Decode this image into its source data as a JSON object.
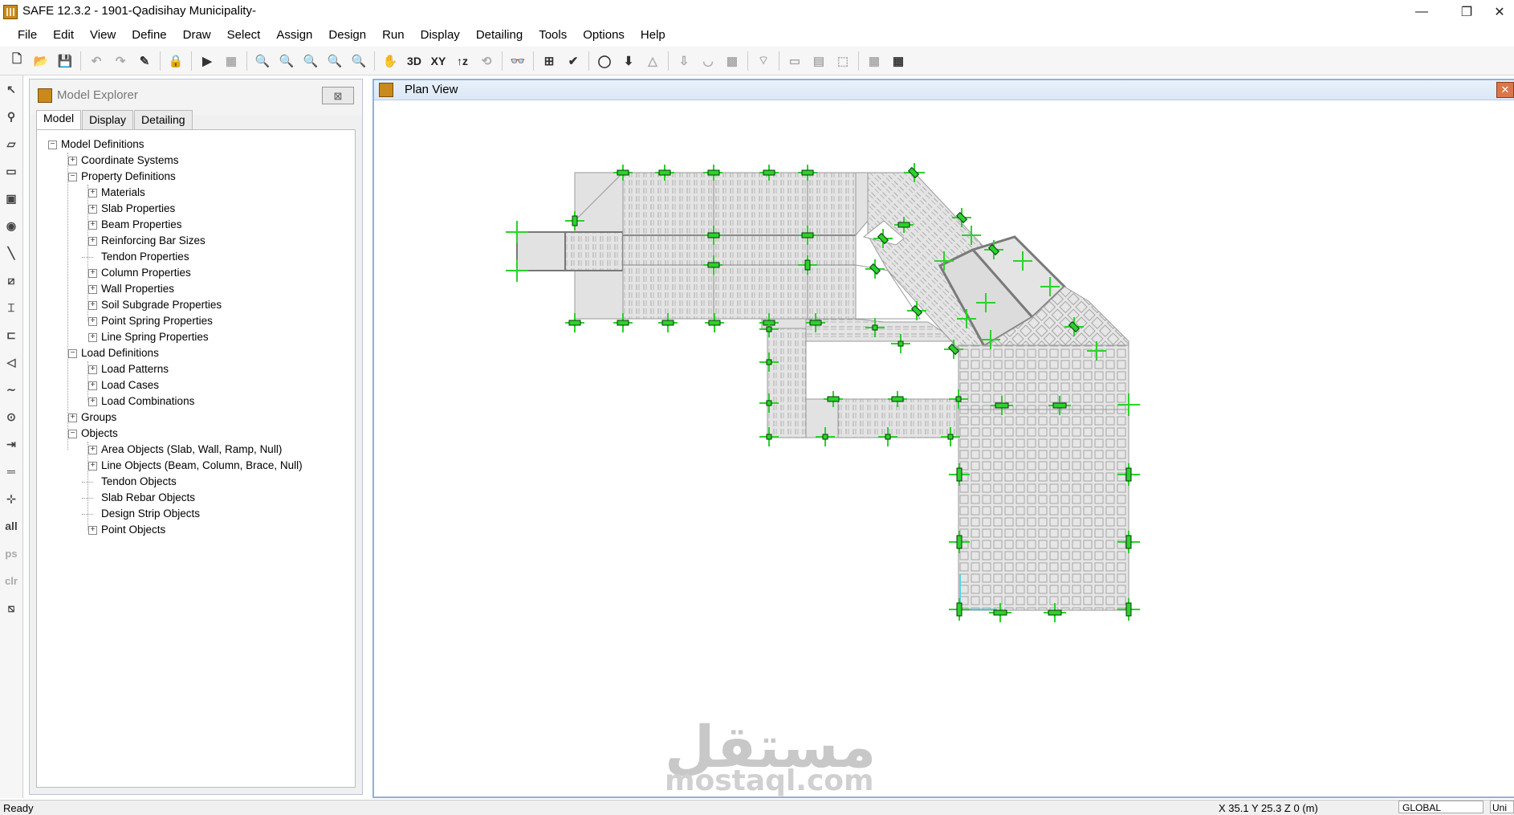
{
  "window": {
    "title": "SAFE 12.3.2 - 1901-Qadisihay Municipality-",
    "minimize": "—",
    "restore": "❐",
    "close": "✕"
  },
  "menu": [
    "File",
    "Edit",
    "View",
    "Define",
    "Draw",
    "Select",
    "Assign",
    "Design",
    "Run",
    "Display",
    "Detailing",
    "Tools",
    "Options",
    "Help"
  ],
  "toolbar": {
    "view_3d": "3D",
    "view_xy": "XY",
    "view_z": "↑z"
  },
  "left_toolbar": {
    "all": "all",
    "ps": "ps",
    "clr": "clr"
  },
  "explorer": {
    "title": "Model Explorer",
    "close": "⊠",
    "tabs": [
      "Model",
      "Display",
      "Detailing"
    ],
    "tree": [
      {
        "label": "Model Definitions",
        "level": 0,
        "box": "−"
      },
      {
        "label": "Coordinate Systems",
        "level": 1,
        "box": "+"
      },
      {
        "label": "Property Definitions",
        "level": 1,
        "box": "−"
      },
      {
        "label": "Materials",
        "level": 2,
        "box": "+"
      },
      {
        "label": "Slab Properties",
        "level": 2,
        "box": "+"
      },
      {
        "label": "Beam Properties",
        "level": 2,
        "box": "+"
      },
      {
        "label": "Reinforcing Bar Sizes",
        "level": 2,
        "box": "+"
      },
      {
        "label": "Tendon Properties",
        "level": 2,
        "box": ""
      },
      {
        "label": "Column Properties",
        "level": 2,
        "box": "+"
      },
      {
        "label": "Wall Properties",
        "level": 2,
        "box": "+"
      },
      {
        "label": "Soil Subgrade Properties",
        "level": 2,
        "box": "+"
      },
      {
        "label": "Point Spring Properties",
        "level": 2,
        "box": "+"
      },
      {
        "label": "Line Spring Properties",
        "level": 2,
        "box": "+"
      },
      {
        "label": "Load Definitions",
        "level": 1,
        "box": "−"
      },
      {
        "label": "Load Patterns",
        "level": 2,
        "box": "+"
      },
      {
        "label": "Load Cases",
        "level": 2,
        "box": "+"
      },
      {
        "label": "Load Combinations",
        "level": 2,
        "box": "+"
      },
      {
        "label": "Groups",
        "level": 1,
        "box": "+"
      },
      {
        "label": "Objects",
        "level": 1,
        "box": "−"
      },
      {
        "label": "Area Objects (Slab, Wall, Ramp, Null)",
        "level": 2,
        "box": "+"
      },
      {
        "label": "Line Objects (Beam, Column, Brace, Null)",
        "level": 2,
        "box": "+"
      },
      {
        "label": "Tendon Objects",
        "level": 2,
        "box": ""
      },
      {
        "label": "Slab Rebar Objects",
        "level": 2,
        "box": ""
      },
      {
        "label": "Design Strip Objects",
        "level": 2,
        "box": ""
      },
      {
        "label": "Point Objects",
        "level": 2,
        "box": "+"
      }
    ]
  },
  "plan_view": {
    "title": "Plan View",
    "close": "✕"
  },
  "watermark": {
    "arabic": "مستقل",
    "latin": "mostaql.com"
  },
  "status": {
    "text": "Ready",
    "coords": "X 35.1  Y 25.3  Z 0  (m)",
    "coord_system": "GLOBAL",
    "units": "Uni"
  },
  "colors": {
    "slab_fill": "#e2e2e2",
    "column_green": "#2bd22b",
    "beam_gray": "#9a9a9a",
    "panel_border": "#8fb1d8"
  }
}
